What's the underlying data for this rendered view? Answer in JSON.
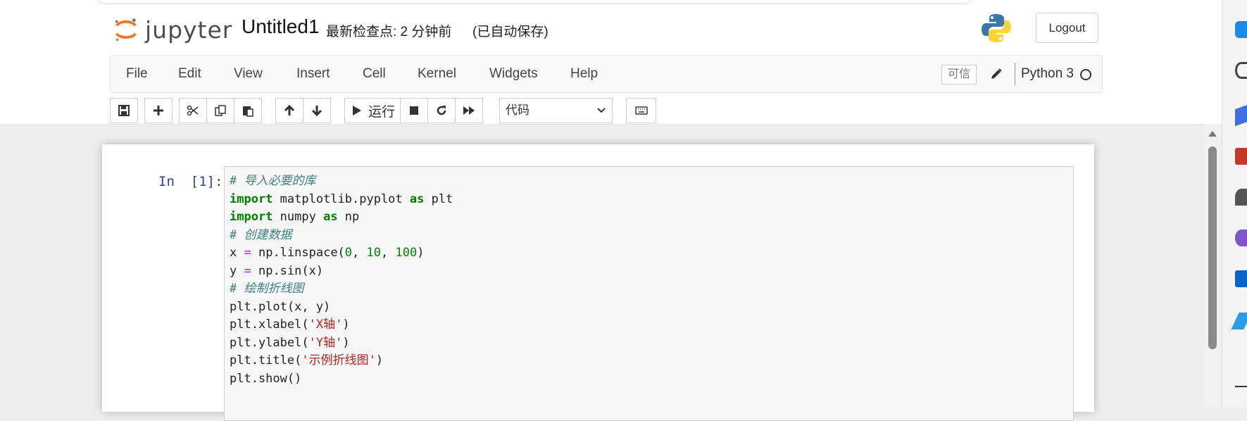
{
  "header": {
    "logo_text": "jupyter",
    "notebook_name": "Untitled1",
    "checkpoint": "最新检查点: 2 分钟前",
    "autosave": "(已自动保存)",
    "logout_label": "Logout"
  },
  "menubar": {
    "items": [
      "File",
      "Edit",
      "View",
      "Insert",
      "Cell",
      "Kernel",
      "Widgets",
      "Help"
    ],
    "trusted_label": "可信",
    "kernel_name": "Python 3"
  },
  "toolbar": {
    "run_label": "运行",
    "cell_type": "代码"
  },
  "cell": {
    "prompt": "In  [1]:",
    "code": [
      "# 导入必要的库",
      "import matplotlib.pyplot as plt",
      "import numpy as np",
      "# 创建数据",
      "x = np.linspace(0, 10, 100)",
      "y = np.sin(x)",
      "# 绘制折线图",
      "plt.plot(x, y)",
      "plt.xlabel('X轴')",
      "plt.ylabel('Y轴')",
      "plt.title('示例折线图')",
      "plt.show()"
    ]
  },
  "colors": {
    "brand_orange": "#f37626",
    "prompt_blue": "#303f9f",
    "keyword_green": "#008000",
    "comment_teal": "#408080",
    "string_red": "#ba2121"
  }
}
